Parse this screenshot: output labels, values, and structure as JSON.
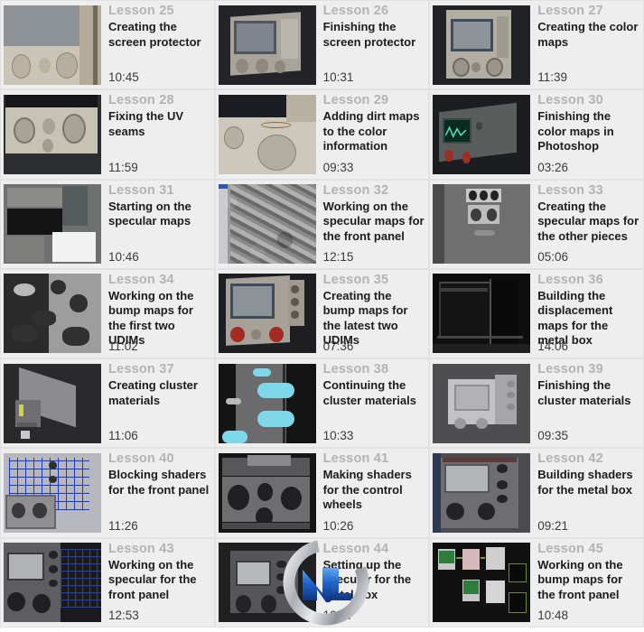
{
  "page": {
    "layout": "lesson-thumbnail-grid",
    "columns": 3,
    "rows": 7,
    "watermark": {
      "name": "nl-logo-watermark",
      "colors": {
        "ring": "#c9ccd0",
        "mark": "#1b5fc4"
      }
    },
    "colors": {
      "cell_background": "#eeeeee",
      "cell_border": "#e2e2e2",
      "lesson_number": "#b3b3b3",
      "lesson_title": "#1c1c1c",
      "duration": "#3a3a3a",
      "page_background": "#ffffff"
    }
  },
  "lessons": [
    {
      "number": "Lesson 25",
      "title": "Creating the screen protector",
      "duration": "10:45",
      "thumb": "scope-screen-closeup-light"
    },
    {
      "number": "Lesson 26",
      "title": "Finishing the screen protector",
      "duration": "10:31",
      "thumb": "scope-3d-grey-angle"
    },
    {
      "number": "Lesson 27",
      "title": "Creating the color maps",
      "duration": "11:39",
      "thumb": "scope-front-panel-dark"
    },
    {
      "number": "Lesson 28",
      "title": "Fixing the UV seams",
      "duration": "11:59",
      "thumb": "knob-panel-photo"
    },
    {
      "number": "Lesson 29",
      "title": "Adding dirt maps to the color information",
      "duration": "09:33",
      "thumb": "dial-closeup-photo"
    },
    {
      "number": "Lesson 30",
      "title": "Finishing the color maps in Photoshop",
      "duration": "03:26",
      "thumb": "scope-green-waveform"
    },
    {
      "number": "Lesson 31",
      "title": "Starting on the specular maps",
      "duration": "10:46",
      "thumb": "photoshop-grey-workspace"
    },
    {
      "number": "Lesson 32",
      "title": "Working on the specular maps for the front panel",
      "duration": "12:15",
      "thumb": "photoshop-greyscale-texture"
    },
    {
      "number": "Lesson 33",
      "title": "Creating the specular maps for the other pieces",
      "duration": "05:06",
      "thumb": "switch-plate-greyscale"
    },
    {
      "number": "Lesson 34",
      "title": "Working on the bump maps for the first two UDIMs",
      "duration": "11:02",
      "thumb": "bump-map-greyscale"
    },
    {
      "number": "Lesson 35",
      "title": "Creating the bump maps for the latest two UDIMs",
      "duration": "07:36",
      "thumb": "scope-red-knobs"
    },
    {
      "number": "Lesson 36",
      "title": "Building the displacement maps for the metal box",
      "duration": "14:06",
      "thumb": "dark-metal-box-render"
    },
    {
      "number": "Lesson 37",
      "title": "Creating cluster materials",
      "duration": "11:06",
      "thumb": "grey-box-render"
    },
    {
      "number": "Lesson 38",
      "title": "Continuing the cluster materials",
      "duration": "10:33",
      "thumb": "cyan-selection-render"
    },
    {
      "number": "Lesson 39",
      "title": "Finishing the cluster materials",
      "duration": "09:35",
      "thumb": "light-grey-box-render"
    },
    {
      "number": "Lesson 40",
      "title": "Blocking shaders for the front panel",
      "duration": "11:26",
      "thumb": "blue-wireframe-render"
    },
    {
      "number": "Lesson 41",
      "title": "Making shaders for the control wheels",
      "duration": "10:26",
      "thumb": "control-wheels-closeup"
    },
    {
      "number": "Lesson 42",
      "title": "Building shaders for the metal box",
      "duration": "09:21",
      "thumb": "metal-box-shader-render"
    },
    {
      "number": "Lesson 43",
      "title": "Working on the specular for the front panel",
      "duration": "12:53",
      "thumb": "panel-with-blue-wireframe"
    },
    {
      "number": "Lesson 44",
      "title": "Setting up the specular for the metal box",
      "duration": "10:27",
      "thumb": "metal-box-specular-render"
    },
    {
      "number": "Lesson 45",
      "title": "Working on the bump maps for the front panel",
      "duration": "10:48",
      "thumb": "node-graph-editor"
    }
  ]
}
